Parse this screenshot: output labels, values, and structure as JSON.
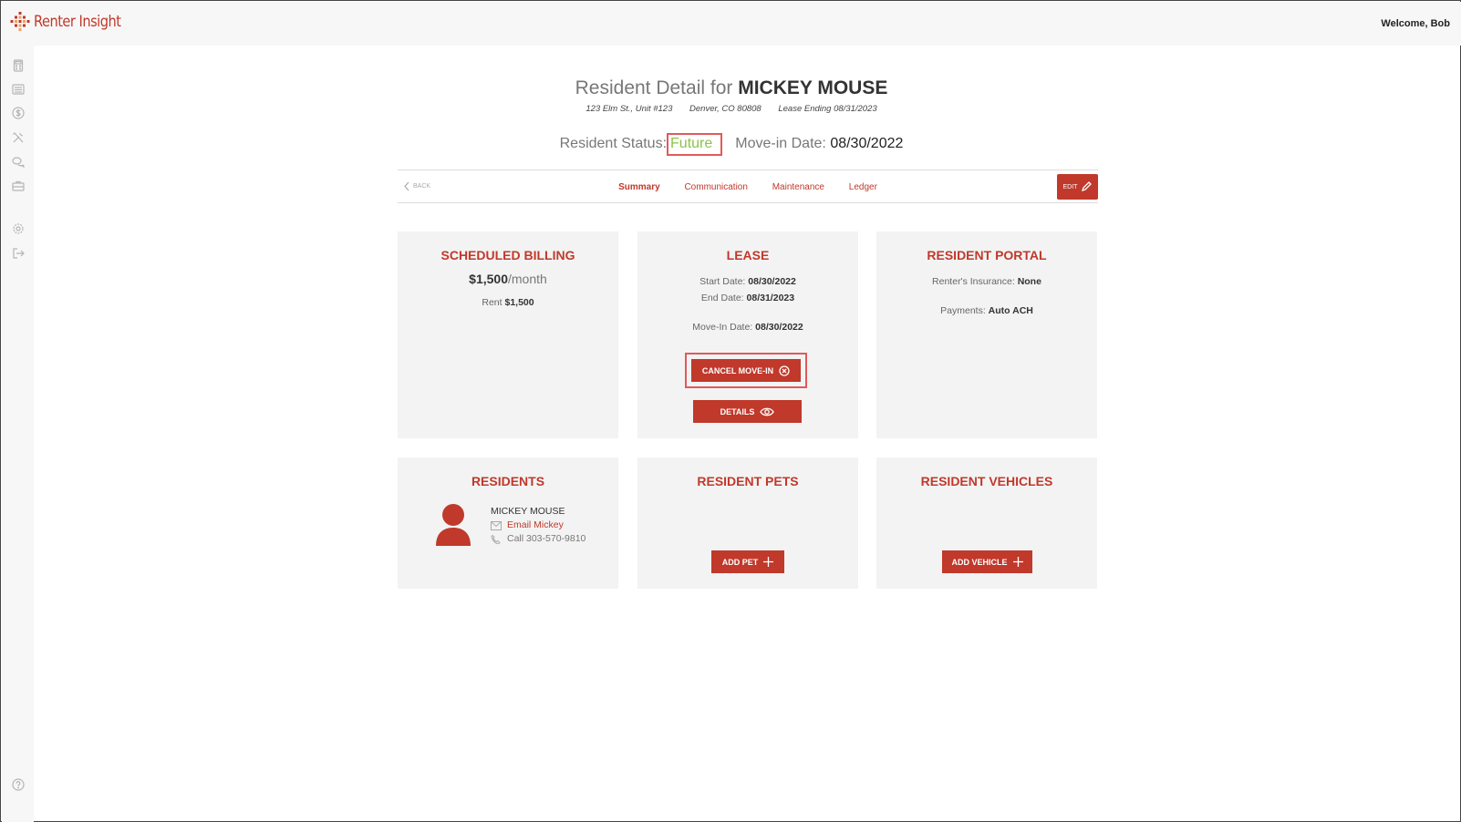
{
  "app": {
    "brand": "Renter Insight",
    "welcome": "Welcome, Bob"
  },
  "header": {
    "title_prefix": "Resident Detail for",
    "resident_name": "MICKEY MOUSE",
    "address": "123 Elm St., Unit #123",
    "city": "Denver, CO 80808",
    "lease_ending": "Lease Ending 08/31/2023",
    "status_label": "Resident Status:",
    "status_value": "Future",
    "movein_label": "Move-in Date:",
    "movein_value": "08/30/2022"
  },
  "nav": {
    "back": "BACK",
    "tabs": [
      "Summary",
      "Communication",
      "Maintenance",
      "Ledger"
    ],
    "edit": "EDIT"
  },
  "billing": {
    "title": "SCHEDULED BILLING",
    "amount": "$1,500",
    "period": "/month",
    "rent_label": "Rent",
    "rent_value": "$1,500"
  },
  "lease": {
    "title": "LEASE",
    "start_label": "Start Date:",
    "start_value": "08/30/2022",
    "end_label": "End Date:",
    "end_value": "08/31/2023",
    "movein_label": "Move-In Date:",
    "movein_value": "08/30/2022",
    "cancel_button": "CANCEL MOVE-IN",
    "details_button": "DETAILS"
  },
  "portal": {
    "title": "RESIDENT PORTAL",
    "insurance_label": "Renter's Insurance:",
    "insurance_value": "None",
    "payments_label": "Payments:",
    "payments_value": "Auto ACH"
  },
  "residents": {
    "title": "RESIDENTS",
    "name": "MICKEY MOUSE",
    "email": "Email Mickey",
    "call": "Call 303-570-9810"
  },
  "pets": {
    "title": "RESIDENT PETS",
    "add_button": "ADD PET"
  },
  "vehicles": {
    "title": "RESIDENT VEHICLES",
    "add_button": "ADD VEHICLE"
  },
  "colors": {
    "brand": "#c0392b",
    "status_future": "#8bc34a",
    "highlight": "#e05a5a"
  }
}
